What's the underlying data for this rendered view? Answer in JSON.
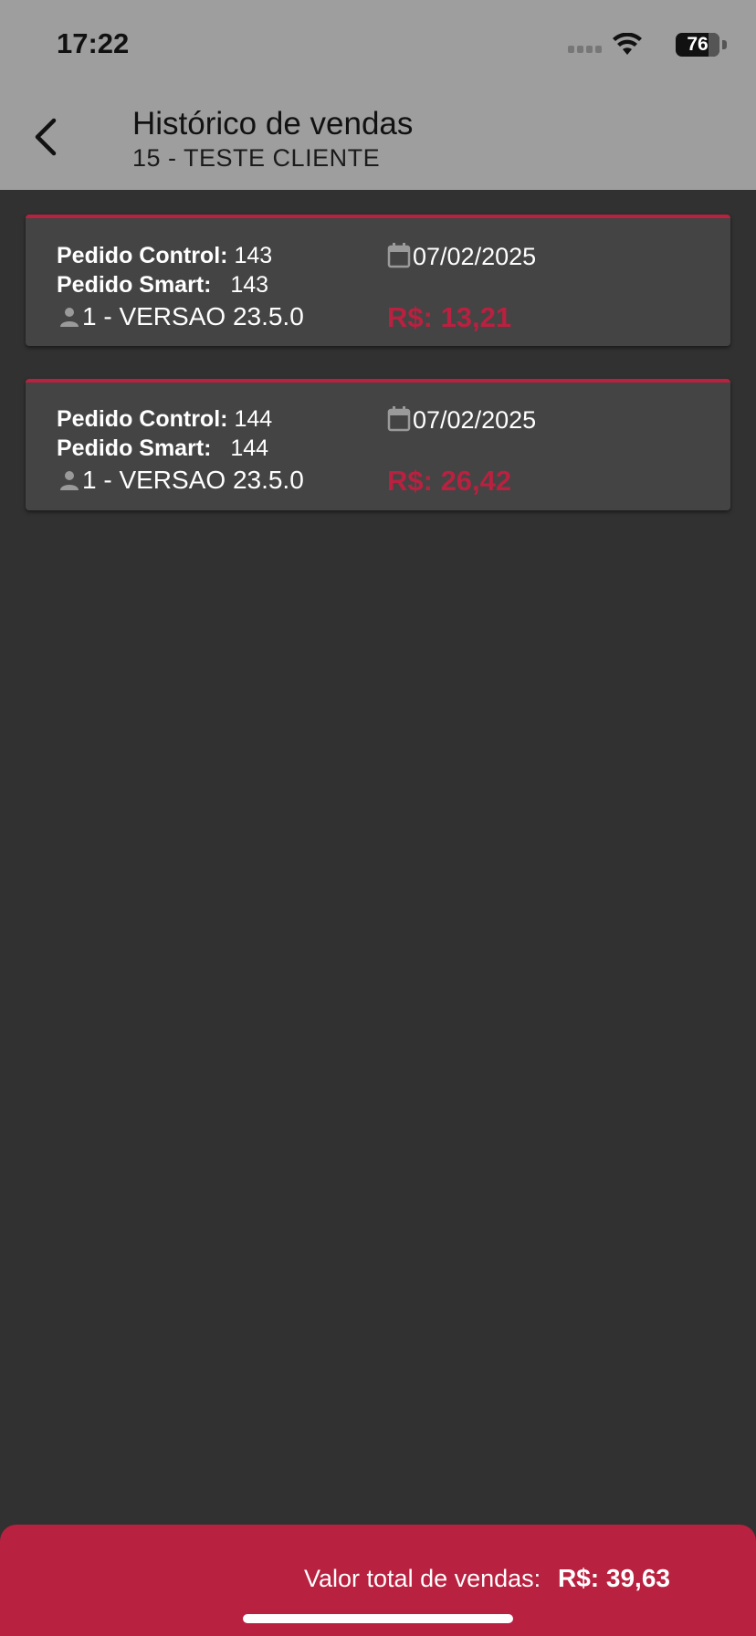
{
  "status_bar": {
    "time": "17:22",
    "battery_level": "76",
    "battery_fraction": 0.76
  },
  "header": {
    "title": "Histórico de vendas",
    "subtitle": "15 - TESTE CLIENTE",
    "back_icon": "chevron-left-icon"
  },
  "orders": [
    {
      "control_label": "Pedido Control:",
      "control_number": "143",
      "smart_label": "Pedido Smart:",
      "smart_number": "143",
      "user": "1 - VERSAO 23.5.0",
      "date": "07/02/2025",
      "price": "R$: 13,21"
    },
    {
      "control_label": "Pedido Control:",
      "control_number": "144",
      "smart_label": "Pedido Smart:",
      "smart_number": "144",
      "user": "1 - VERSAO 23.5.0",
      "date": "07/02/2025",
      "price": "R$: 26,42"
    }
  ],
  "footer": {
    "total_label": "Valor total de vendas:",
    "total_value": "R$: 39,63"
  },
  "colors": {
    "accent": "#b8213f",
    "header_bg": "#9e9e9e",
    "page_bg": "#313131",
    "card_bg": "#444444"
  }
}
